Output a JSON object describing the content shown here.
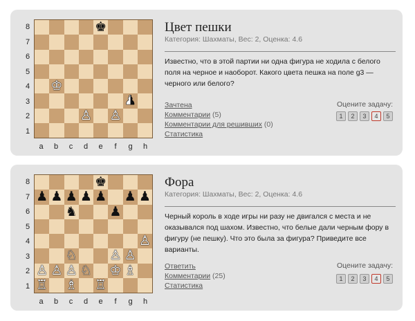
{
  "rating_label": "Оцените задачу:",
  "rating_values": [
    "1",
    "2",
    "3",
    "4",
    "5"
  ],
  "files": [
    "a",
    "b",
    "c",
    "d",
    "e",
    "f",
    "g",
    "h"
  ],
  "ranks": [
    "8",
    "7",
    "6",
    "5",
    "4",
    "3",
    "2",
    "1"
  ],
  "puzzles": [
    {
      "title": "Цвет пешки",
      "meta": "Категория: Шахматы,  Вес: 2,  Оценка: 4.6",
      "description": "Известно, что в этой партии ни одна фигура не ходила с белого поля на черное и наоборот. Какого цвета пешка на поле g3 — черного или белого?",
      "links": [
        {
          "label": "Зачтена",
          "count": ""
        },
        {
          "label": "Комментарии",
          "count": " (5)"
        },
        {
          "label": "Комментарии для решивших",
          "count": " (0)"
        },
        {
          "label": "Статистика",
          "count": ""
        }
      ],
      "selected_rating": 4,
      "pieces": [
        {
          "sq": "e8",
          "glyph": "♚",
          "color": "b"
        },
        {
          "sq": "b4",
          "glyph": "♔",
          "color": "w"
        },
        {
          "sq": "g3",
          "glyph": "♟",
          "color": "half"
        },
        {
          "sq": "d2",
          "glyph": "♙",
          "color": "w"
        },
        {
          "sq": "f2",
          "glyph": "♙",
          "color": "w"
        }
      ]
    },
    {
      "title": "Фора",
      "meta": "Категория: Шахматы,  Вес: 2,  Оценка: 4.6",
      "description": "Черный король в ходе игры ни разу не двигался с места и не оказывался под шахом. Известно, что белые дали черным фору в фигуру (не пешку). Что это была за фигура? Приведите все варианты.",
      "links": [
        {
          "label": "Ответить",
          "count": ""
        },
        {
          "label": "Комментарии",
          "count": " (25)"
        },
        {
          "label": "Статистика",
          "count": ""
        }
      ],
      "selected_rating": 4,
      "pieces": [
        {
          "sq": "e8",
          "glyph": "♚",
          "color": "b"
        },
        {
          "sq": "a7",
          "glyph": "♟",
          "color": "b"
        },
        {
          "sq": "b7",
          "glyph": "♟",
          "color": "b"
        },
        {
          "sq": "c7",
          "glyph": "♟",
          "color": "b"
        },
        {
          "sq": "d7",
          "glyph": "♟",
          "color": "b"
        },
        {
          "sq": "e7",
          "glyph": "♟",
          "color": "b"
        },
        {
          "sq": "g7",
          "glyph": "♟",
          "color": "b"
        },
        {
          "sq": "h7",
          "glyph": "♟",
          "color": "b"
        },
        {
          "sq": "c6",
          "glyph": "♞",
          "color": "b"
        },
        {
          "sq": "f6",
          "glyph": "♟",
          "color": "b"
        },
        {
          "sq": "h4",
          "glyph": "♙",
          "color": "w"
        },
        {
          "sq": "c3",
          "glyph": "♘",
          "color": "w"
        },
        {
          "sq": "f3",
          "glyph": "♙",
          "color": "w"
        },
        {
          "sq": "g3",
          "glyph": "♙",
          "color": "w"
        },
        {
          "sq": "a2",
          "glyph": "♙",
          "color": "w"
        },
        {
          "sq": "b2",
          "glyph": "♙",
          "color": "w"
        },
        {
          "sq": "c2",
          "glyph": "♙",
          "color": "w"
        },
        {
          "sq": "d2",
          "glyph": "♘",
          "color": "w"
        },
        {
          "sq": "f2",
          "glyph": "♔",
          "color": "w"
        },
        {
          "sq": "g2",
          "glyph": "♗",
          "color": "w"
        },
        {
          "sq": "a1",
          "glyph": "♖",
          "color": "w"
        },
        {
          "sq": "c1",
          "glyph": "♗",
          "color": "w"
        },
        {
          "sq": "e1",
          "glyph": "♖",
          "color": "w"
        }
      ]
    }
  ]
}
